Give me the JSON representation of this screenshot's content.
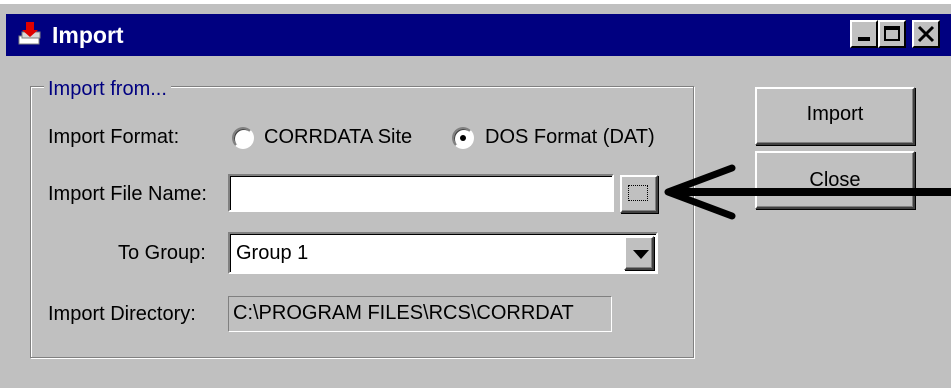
{
  "window": {
    "title": "Import",
    "icon": "import-app-icon",
    "controls": [
      "minimize-icon",
      "maximize-icon",
      "close-icon"
    ]
  },
  "group": {
    "legend": "Import from..."
  },
  "format": {
    "label": "Import Format:",
    "options": [
      {
        "label": "CORRDATA Site",
        "selected": false
      },
      {
        "label": "DOS Format (DAT)",
        "selected": true
      }
    ]
  },
  "file": {
    "label": "Import File Name:",
    "value": "",
    "browse_icon": "ellipsis-browse-icon"
  },
  "group_select": {
    "label": "To Group:",
    "value": "Group 1"
  },
  "directory": {
    "label": "Import Directory:",
    "value": "C:\\PROGRAM FILES\\RCS\\CORRDAT"
  },
  "buttons": {
    "import": "Import",
    "close": "Close"
  },
  "annotation": {
    "icon": "pointer-arrow-icon",
    "color": "#000000"
  },
  "colors": {
    "titlebar": "#000080",
    "face": "#c0c0c0",
    "legend_text": "#000080"
  }
}
